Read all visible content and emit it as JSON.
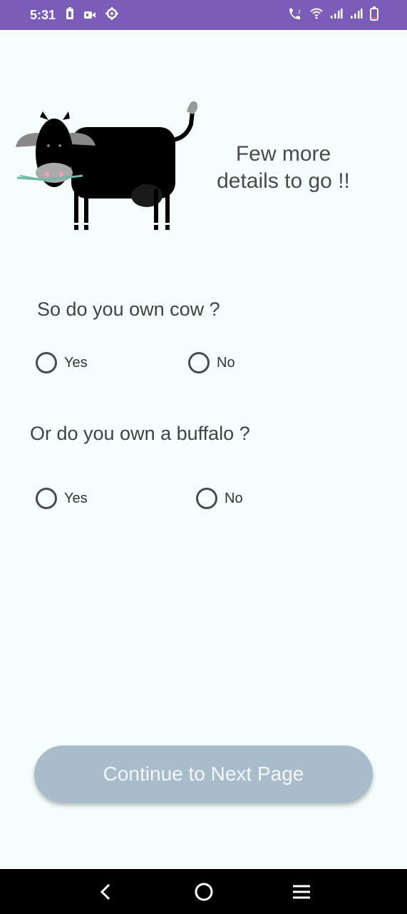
{
  "status_bar": {
    "time": "5:31",
    "left_icons": [
      "battery-saver-icon",
      "video-icon",
      "settings-icon"
    ],
    "right_icons": [
      "volte-call-icon",
      "wifi-icon",
      "signal-icon",
      "signal-icon",
      "battery-icon"
    ],
    "background": "#7b5cb8"
  },
  "hero": {
    "image": "cow-illustration",
    "text": "Few more details to go !!"
  },
  "questions": [
    {
      "label": "So do you own cow ?",
      "options": [
        "Yes",
        "No"
      ]
    },
    {
      "label": "Or do you own a buffalo ?",
      "options": [
        "Yes",
        "No"
      ]
    }
  ],
  "continue_button": {
    "label": "Continue to Next Page",
    "color": "#a9bccc"
  },
  "nav_bar": {
    "icons": [
      "back-icon",
      "home-icon",
      "menu-icon"
    ]
  }
}
